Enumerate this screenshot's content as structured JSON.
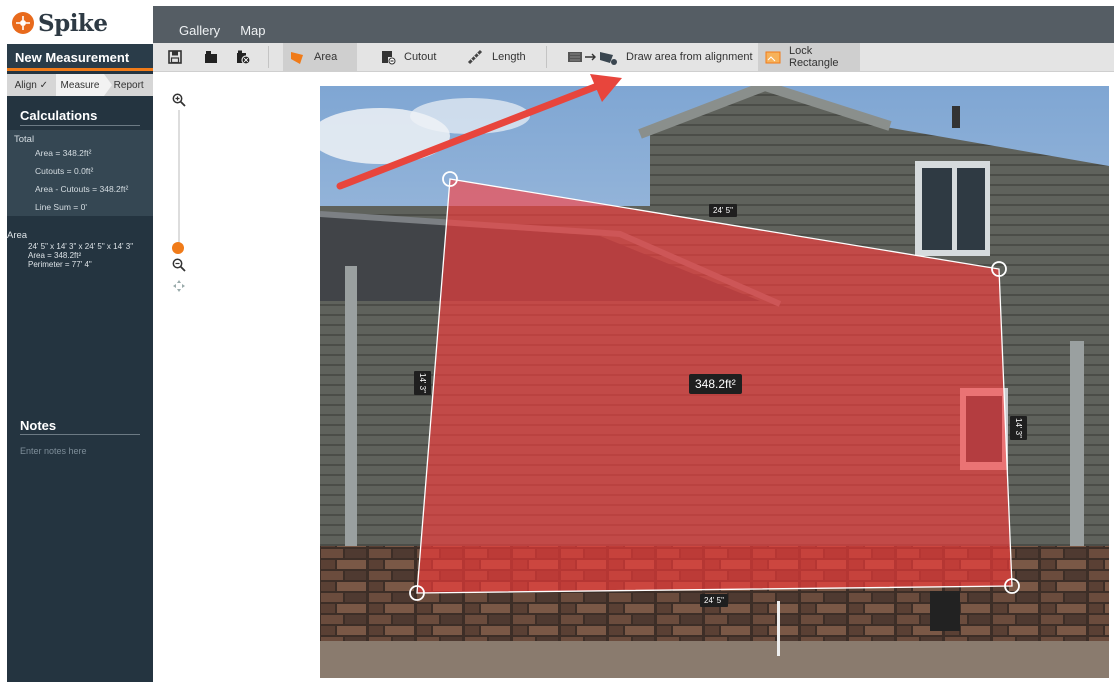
{
  "app": {
    "name": "Spike"
  },
  "topnav": {
    "gallery": "Gallery",
    "map": "Map"
  },
  "sidebar": {
    "title": "New Measurement",
    "steps": [
      "Align ✓",
      "Measure",
      "Report"
    ],
    "calculations_title": "Calculations",
    "total_label": "Total",
    "total_lines": [
      "Area = 348.2ft²",
      "Cutouts = 0.0ft²",
      "Area - Cutouts = 348.2ft²",
      "Line Sum = 0'"
    ],
    "area_title": "Area",
    "area_lines": [
      "24' 5\" x 14' 3\" x 24' 5\" x 14' 3\"",
      "Area = 348.2ft²",
      "Perimeter = 77' 4\""
    ],
    "notes_title": "Notes",
    "notes_placeholder": "Enter notes here"
  },
  "toolbar": {
    "area": "Area",
    "cutout": "Cutout",
    "length": "Length",
    "draw_from_alignment": "Draw area from alignment",
    "lock_rectangle": "Lock Rectangle"
  },
  "canvas": {
    "area_value": "348.2ft²",
    "dims": {
      "top": "24' 5\"",
      "bottom": "24' 5\"",
      "left": "14' 3\"",
      "right": "14' 3\""
    }
  },
  "colors": {
    "accent": "#f07b19",
    "sidebar": "#243440",
    "overlay": "#ff3b3b",
    "arrow": "#e8453c"
  }
}
